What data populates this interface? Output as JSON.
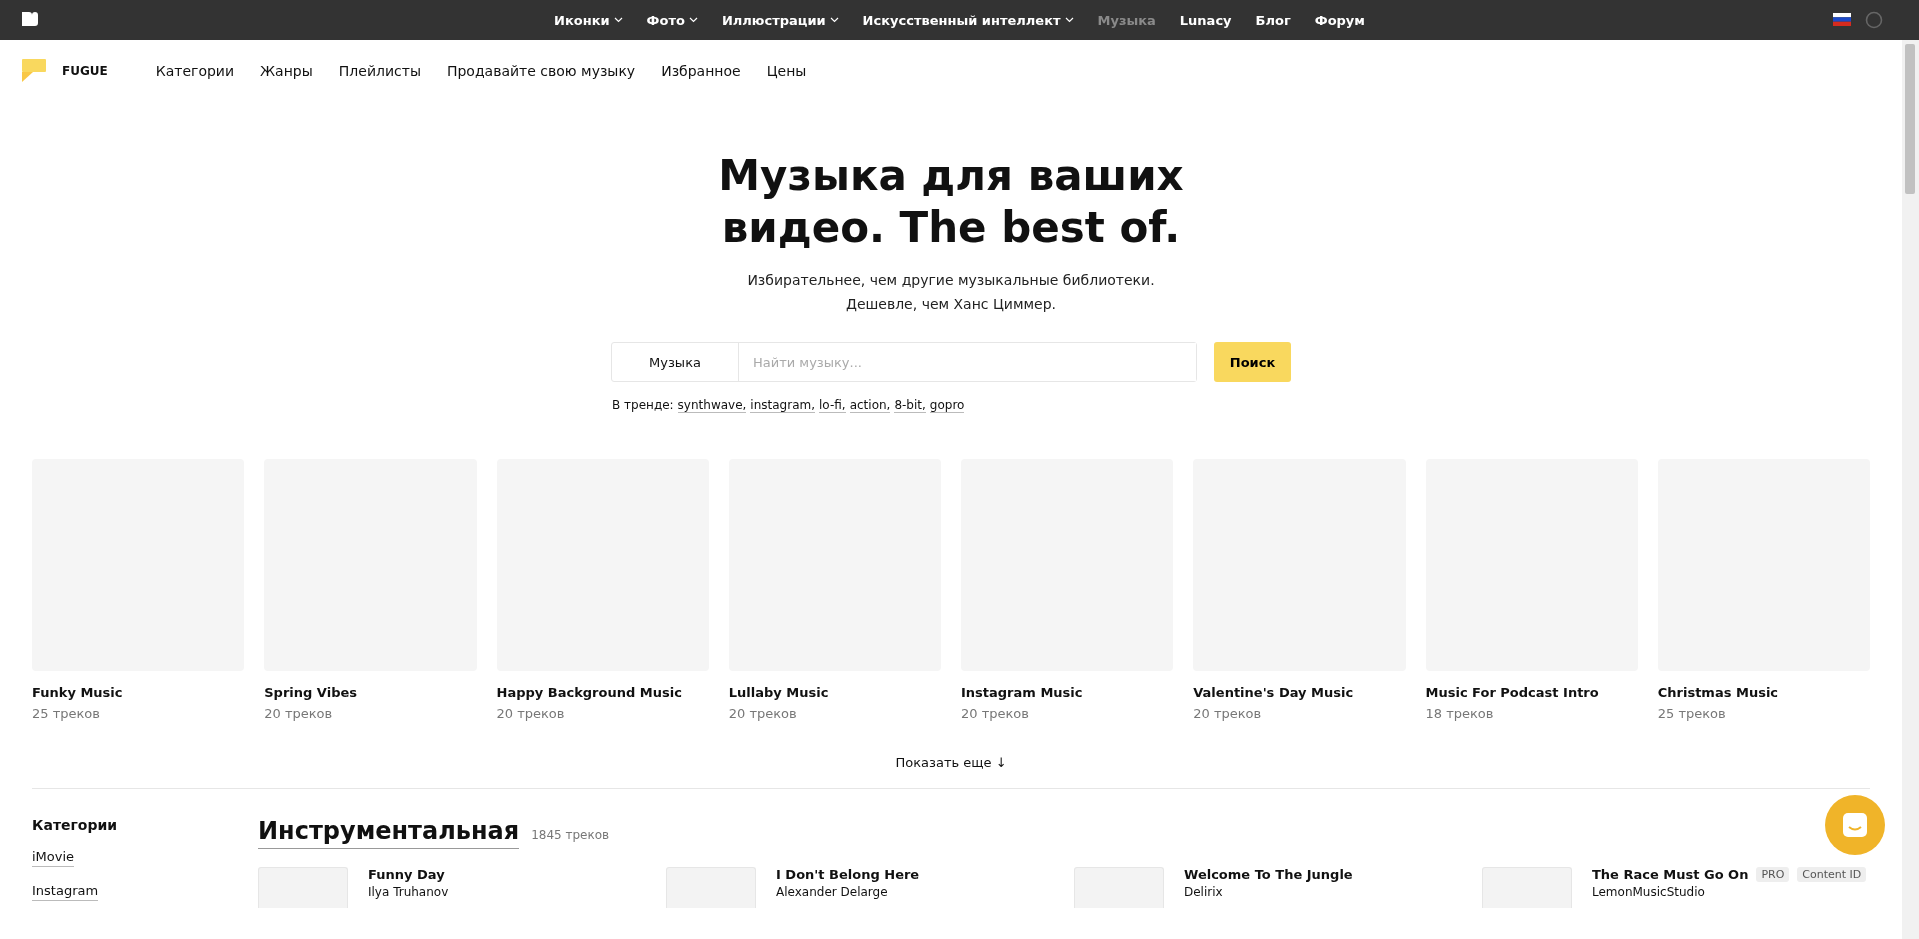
{
  "topbar": {
    "items": [
      {
        "label": "Иконки",
        "dropdown": true,
        "selected": false
      },
      {
        "label": "Фото",
        "dropdown": true,
        "selected": false
      },
      {
        "label": "Иллюстрации",
        "dropdown": true,
        "selected": false
      },
      {
        "label": "Искусственный интеллект",
        "dropdown": true,
        "selected": false
      },
      {
        "label": "Музыка",
        "dropdown": false,
        "selected": true
      },
      {
        "label": "Lunacy",
        "dropdown": false,
        "selected": false
      },
      {
        "label": "Блог",
        "dropdown": false,
        "selected": false
      },
      {
        "label": "Форум",
        "dropdown": false,
        "selected": false
      }
    ]
  },
  "subnav": {
    "brand": "FUGUE",
    "items": [
      "Категории",
      "Жанры",
      "Плейлисты",
      "Продавайте свою музыку",
      "Избранное",
      "Цены"
    ]
  },
  "hero": {
    "title_lines": [
      "Музыка для ваших",
      "видео. The best of."
    ],
    "subtitle_lines": [
      "Избирательнее, чем другие музыкальные библиотеки.",
      "Дешевле, чем Ханс Циммер."
    ]
  },
  "search": {
    "category": "Музыка",
    "placeholder": "Найти музыку...",
    "button": "Поиск",
    "trending_label": "В тренде:",
    "trending": [
      "synthwave,",
      "instagram,",
      "lo-fi,",
      "action,",
      "8-bit,",
      "gopro"
    ]
  },
  "playlists": [
    {
      "title": "Funky Music",
      "count": "25 треков"
    },
    {
      "title": "Spring Vibes",
      "count": "20 треков"
    },
    {
      "title": "Happy Background Music",
      "count": "20 треков"
    },
    {
      "title": "Lullaby Music",
      "count": "20 треков"
    },
    {
      "title": "Instagram Music",
      "count": "20 треков"
    },
    {
      "title": "Valentine's Day Music",
      "count": "20 треков"
    },
    {
      "title": "Music For Podcast Intro",
      "count": "18 треков"
    },
    {
      "title": "Christmas Music",
      "count": "25 треков"
    }
  ],
  "show_more": "Показать еще ↓",
  "sidebar": {
    "title": "Категории",
    "items": [
      "iMovie",
      "Instagram"
    ]
  },
  "section": {
    "title": "Инструментальная",
    "count": "1845 треков",
    "tracks": [
      {
        "title": "Funny Day",
        "artist": "Ilya Truhanov"
      },
      {
        "title": "I Don't Belong Here",
        "artist": "Alexander Delarge"
      },
      {
        "title": "Welcome To The Jungle",
        "artist": "Delirix"
      },
      {
        "title": "The Race Must Go On",
        "artist": "LemonMusicStudio",
        "badges": [
          "PRO",
          "Content ID"
        ]
      }
    ]
  }
}
